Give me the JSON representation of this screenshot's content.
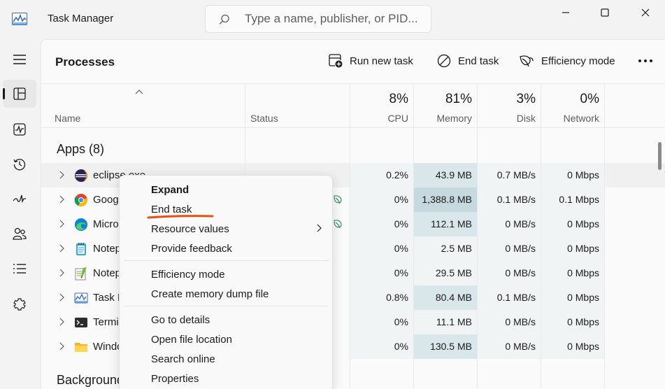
{
  "window": {
    "title": "Task Manager",
    "search_placeholder": "Type a name, publisher, or PID..."
  },
  "nav": {
    "items": [
      "menu-icon",
      "processes-icon",
      "performance-icon",
      "app-history-icon",
      "startup-apps-icon",
      "users-icon",
      "details-icon",
      "services-icon"
    ],
    "active": "processes-icon"
  },
  "page": {
    "title": "Processes",
    "run_new_task": "Run new task",
    "end_task": "End task",
    "efficiency_mode": "Efficiency mode"
  },
  "columns": {
    "name": "Name",
    "status": "Status",
    "cpu_pct": "8%",
    "cpu": "CPU",
    "memory_pct": "81%",
    "memory": "Memory",
    "disk_pct": "3%",
    "disk": "Disk",
    "network_pct": "0%",
    "network": "Network"
  },
  "groups": {
    "apps": "Apps (8)",
    "background": "Background"
  },
  "rows": [
    {
      "name": "eclipse.exe",
      "icon": "eclipse-icon",
      "cpu": "0.2%",
      "memory": "43.9 MB",
      "disk": "0.7 MB/s",
      "network": "0 Mbps",
      "efficiency": false
    },
    {
      "name": "Goog",
      "icon": "chrome-icon",
      "cpu": "0%",
      "memory": "1,388.8 MB",
      "disk": "0.1 MB/s",
      "network": "0.1 Mbps",
      "efficiency": true
    },
    {
      "name": "Micro",
      "icon": "edge-icon",
      "cpu": "0%",
      "memory": "112.1 MB",
      "disk": "0 MB/s",
      "network": "0 Mbps",
      "efficiency": true
    },
    {
      "name": "Notep",
      "icon": "notepad-icon",
      "cpu": "0%",
      "memory": "2.5 MB",
      "disk": "0 MB/s",
      "network": "0 Mbps",
      "efficiency": false
    },
    {
      "name": "Notep",
      "icon": "notepadpp-icon",
      "cpu": "0%",
      "memory": "29.5 MB",
      "disk": "0 MB/s",
      "network": "0 Mbps",
      "efficiency": false
    },
    {
      "name": "Task M",
      "icon": "task-manager-icon",
      "cpu": "0.8%",
      "memory": "80.4 MB",
      "disk": "0.1 MB/s",
      "network": "0 Mbps",
      "efficiency": false
    },
    {
      "name": "Termi",
      "icon": "terminal-icon",
      "cpu": "0%",
      "memory": "11.1 MB",
      "disk": "0 MB/s",
      "network": "0 Mbps",
      "efficiency": false
    },
    {
      "name": "Windo",
      "icon": "folder-icon",
      "cpu": "0%",
      "memory": "130.5 MB",
      "disk": "0 MB/s",
      "network": "0 Mbps",
      "efficiency": false
    }
  ],
  "context_menu": {
    "expand": "Expand",
    "end_task": "End task",
    "resource_values": "Resource values",
    "provide_feedback": "Provide feedback",
    "efficiency_mode": "Efficiency mode",
    "create_dump": "Create memory dump file",
    "go_to_details": "Go to details",
    "open_file_location": "Open file location",
    "search_online": "Search online",
    "properties": "Properties"
  },
  "colors": {
    "annotation": "#e8500f",
    "heat_light": "#f0f4f5",
    "heat_medium": "#d9e6ea",
    "heat_strong": "#c5d9df"
  }
}
